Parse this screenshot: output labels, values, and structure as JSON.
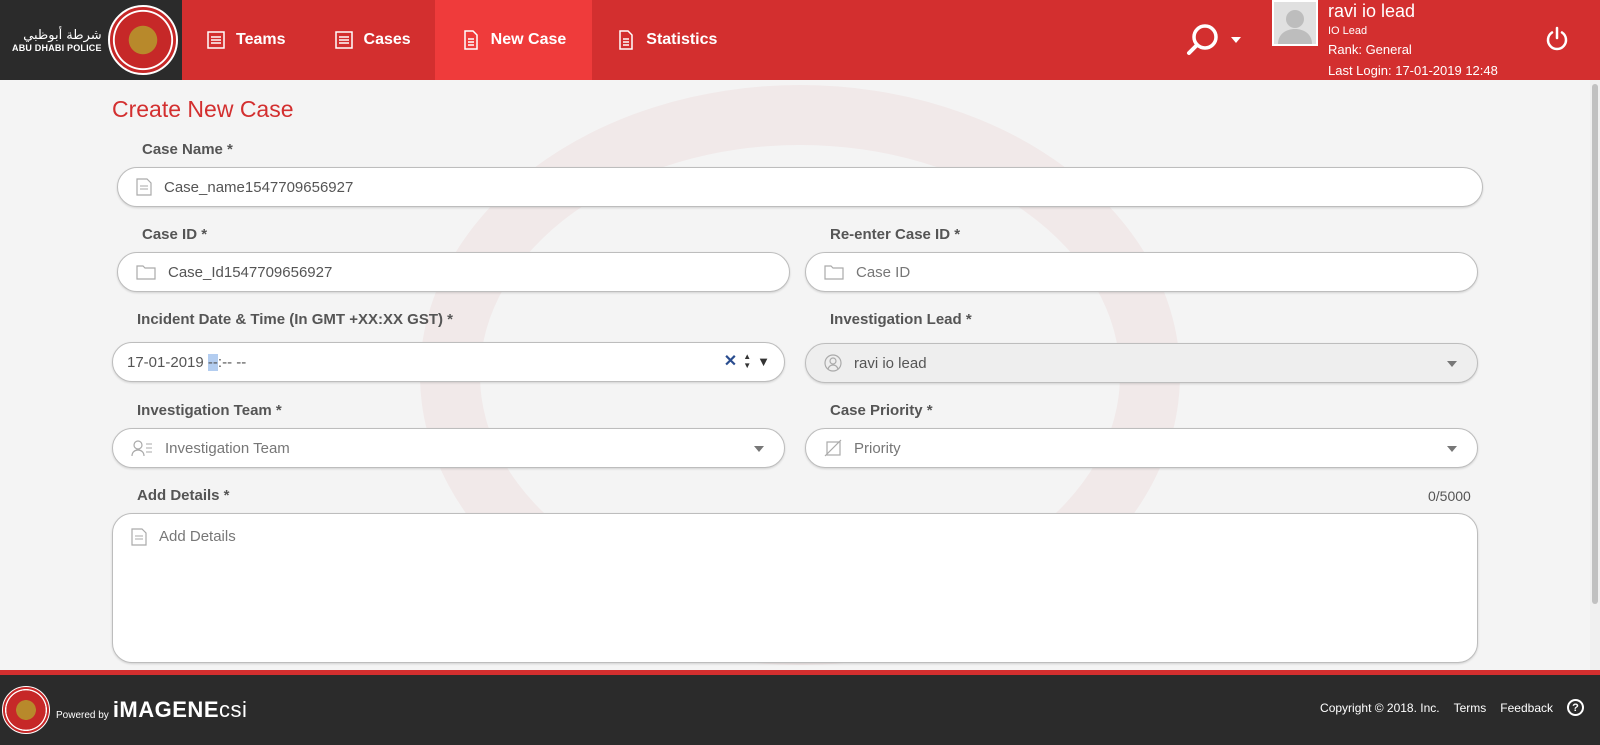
{
  "header": {
    "logo": {
      "arabic": "شرطة أبوظبي",
      "english": "ABU DHABI POLICE"
    },
    "nav": [
      {
        "label": "Teams",
        "icon": "list-icon"
      },
      {
        "label": "Cases",
        "icon": "list-icon"
      },
      {
        "label": "New Case",
        "icon": "document-icon",
        "active": true
      },
      {
        "label": "Statistics",
        "icon": "document-icon"
      }
    ],
    "user": {
      "name": "ravi io lead",
      "role": "IO Lead",
      "rank": "Rank: General",
      "last_login": "Last Login: 17-01-2019 12:48"
    }
  },
  "form": {
    "title": "Create New Case",
    "case_name": {
      "label": "Case Name *",
      "value": "Case_name1547709656927"
    },
    "case_id": {
      "label": "Case ID *",
      "value": "Case_Id1547709656927"
    },
    "reenter_case_id": {
      "label": "Re-enter Case ID *",
      "placeholder": "Case ID"
    },
    "incident_datetime": {
      "label": "Incident Date & Time (In GMT +XX:XX GST) *",
      "date": "17-01-2019",
      "hour": "--",
      "rest": ":-- --"
    },
    "investigation_lead": {
      "label": "Investigation Lead *",
      "value": "ravi io lead"
    },
    "investigation_team": {
      "label": "Investigation Team *",
      "placeholder": "Investigation Team"
    },
    "case_priority": {
      "label": "Case Priority *",
      "placeholder": "Priority"
    },
    "details": {
      "label": "Add Details *",
      "placeholder": "Add Details",
      "counter": "0/5000"
    }
  },
  "footer": {
    "powered_by": "Powered by",
    "brand_prefix": "iMAGENE",
    "brand_suffix": "csi",
    "copyright": "Copyright © 2018. Inc.",
    "terms": "Terms",
    "feedback": "Feedback"
  },
  "colors": {
    "primary": "#d32f2f",
    "active_tab": "#ef3b3b",
    "dark": "#2b2b2b"
  }
}
